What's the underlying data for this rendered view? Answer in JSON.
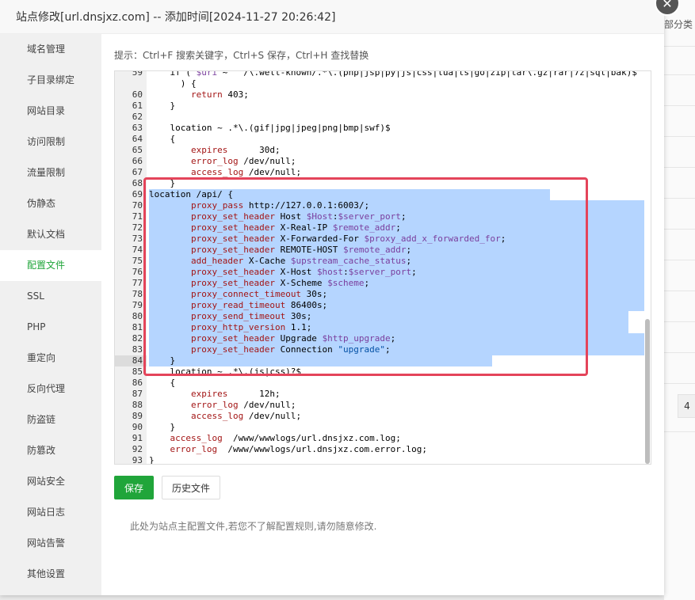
{
  "dialog": {
    "title": "站点修改[url.dnsjxz.com] -- 添加时间[2024-11-27 20:26:42]",
    "close_icon": "close-icon"
  },
  "background": {
    "header_fragment": "部分类",
    "pager_value": "4"
  },
  "sidebar": {
    "items": [
      {
        "label": "域名管理"
      },
      {
        "label": "子目录绑定"
      },
      {
        "label": "网站目录"
      },
      {
        "label": "访问限制"
      },
      {
        "label": "流量限制"
      },
      {
        "label": "伪静态"
      },
      {
        "label": "默认文档"
      },
      {
        "label": "配置文件",
        "active": true
      },
      {
        "label": "SSL"
      },
      {
        "label": "PHP"
      },
      {
        "label": "重定向"
      },
      {
        "label": "反向代理"
      },
      {
        "label": "防盗链"
      },
      {
        "label": "防篡改"
      },
      {
        "label": "网站安全"
      },
      {
        "label": "网站日志"
      },
      {
        "label": "网站告警"
      },
      {
        "label": "其他设置"
      }
    ]
  },
  "tip": "提示：Ctrl+F 搜索关键字，Ctrl+S 保存，Ctrl+H 查找替换",
  "editor": {
    "active_line": "84",
    "selected_from": "69",
    "selected_to": "84",
    "lines": [
      {
        "n": "59",
        "t": "    if ( $uri ~ \"^/\\.well-known/.*\\.(php|jsp|py|js|css|lua|ts|go|zip|tar\\.gz|rar|7z|sql|bak)$\""
      },
      {
        "n": "",
        "t": "      ) {"
      },
      {
        "n": "60",
        "t": "        return 403;"
      },
      {
        "n": "61",
        "t": "    }"
      },
      {
        "n": "62",
        "t": ""
      },
      {
        "n": "63",
        "t": "    location ~ .*\\.(gif|jpg|jpeg|png|bmp|swf)$"
      },
      {
        "n": "64",
        "t": "    {"
      },
      {
        "n": "65",
        "t": "        expires      30d;"
      },
      {
        "n": "66",
        "t": "        error_log /dev/null;"
      },
      {
        "n": "67",
        "t": "        access_log /dev/null;"
      },
      {
        "n": "68",
        "t": "    }"
      },
      {
        "n": "69",
        "t": "location /api/ {"
      },
      {
        "n": "70",
        "t": "        proxy_pass http://127.0.0.1:6003/;"
      },
      {
        "n": "71",
        "t": "        proxy_set_header Host $Host:$server_port;"
      },
      {
        "n": "72",
        "t": "        proxy_set_header X-Real-IP $remote_addr;"
      },
      {
        "n": "73",
        "t": "        proxy_set_header X-Forwarded-For $proxy_add_x_forwarded_for;"
      },
      {
        "n": "74",
        "t": "        proxy_set_header REMOTE-HOST $remote_addr;"
      },
      {
        "n": "75",
        "t": "        add_header X-Cache $upstream_cache_status;"
      },
      {
        "n": "76",
        "t": "        proxy_set_header X-Host $host:$server_port;"
      },
      {
        "n": "77",
        "t": "        proxy_set_header X-Scheme $scheme;"
      },
      {
        "n": "78",
        "t": "        proxy_connect_timeout 30s;"
      },
      {
        "n": "79",
        "t": "        proxy_read_timeout 86400s;"
      },
      {
        "n": "80",
        "t": "        proxy_send_timeout 30s;"
      },
      {
        "n": "81",
        "t": "        proxy_http_version 1.1;"
      },
      {
        "n": "82",
        "t": "        proxy_set_header Upgrade $http_upgrade;"
      },
      {
        "n": "83",
        "t": "        proxy_set_header Connection \"upgrade\";"
      },
      {
        "n": "84",
        "t": "    }"
      },
      {
        "n": "85",
        "t": "    location ~ .*\\.(js|css)?$"
      },
      {
        "n": "86",
        "t": "    {"
      },
      {
        "n": "87",
        "t": "        expires      12h;"
      },
      {
        "n": "88",
        "t": "        error_log /dev/null;"
      },
      {
        "n": "89",
        "t": "        access_log /dev/null;"
      },
      {
        "n": "90",
        "t": "    }"
      },
      {
        "n": "91",
        "t": "    access_log  /www/wwwlogs/url.dnsjxz.com.log;"
      },
      {
        "n": "92",
        "t": "    error_log  /www/wwwlogs/url.dnsjxz.com.error.log;"
      },
      {
        "n": "93",
        "t": "}"
      }
    ]
  },
  "buttons": {
    "save": "保存",
    "history": "历史文件"
  },
  "note": "此处为站点主配置文件,若您不了解配置规则,请勿随意修改.",
  "colors": {
    "accent": "#20a53a",
    "selection": "#b5d5ff",
    "highlight_border": "#e4445a"
  }
}
